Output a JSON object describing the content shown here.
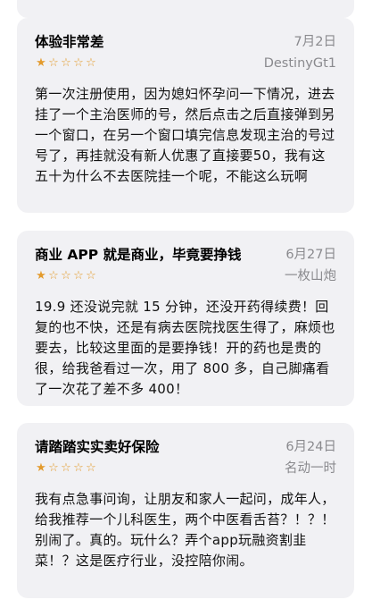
{
  "reviews": [
    {
      "title": "体验非常差",
      "date": "7月2日",
      "author": "DestinyGt1",
      "rating": 1,
      "body": "第一次注册使用，因为媳妇怀孕问一下情况，进去挂了一个主治医师的号，然后点击之后直接弹到另一个窗口，在另一个窗口填完信息发现主治的号过号了，再挂就没有新人优惠了直接要50，我有这五十为什么不去医院挂一个呢，不能这么玩啊"
    },
    {
      "title": "商业 APP 就是商业，毕竟要挣钱",
      "date": "6月27日",
      "author": "一枚山炮",
      "rating": 1,
      "body": "19.9 还没说完就 15 分钟，还没开药得续费！回复的也不快，还是有病去医院找医生得了，麻烦也要去，比较这里面的是要挣钱！开的药也是贵的很，给我爸看过一次，用了 800 多，自己脚痛看了一次花了差不多 400！"
    },
    {
      "title": "请踏踏实实卖好保险",
      "date": "6月24日",
      "author": "名动一时",
      "rating": 1,
      "body": "我有点急事问询，让朋友和家人一起问，成年人，给我推荐一个儿科医生，两个中医看舌苔？！？！ 别闹了。真的。玩什么？弄个app玩融资割韭菜！？这是医疗行业，没控陪你闹。"
    }
  ],
  "star_glyphs": {
    "filled": "★",
    "empty": "☆"
  },
  "colors": {
    "star": "#e39b2d",
    "meta": "#8a8a8e",
    "card": "#f1f1f4"
  }
}
